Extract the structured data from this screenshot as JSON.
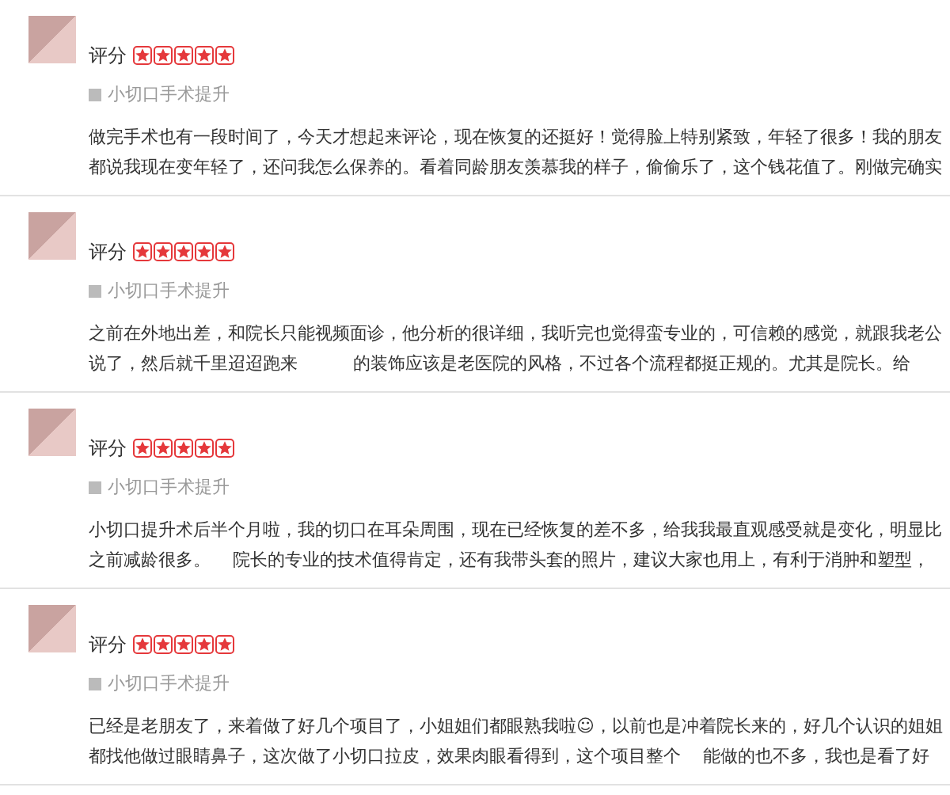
{
  "reviews": [
    {
      "rating_label": "评分",
      "stars": 5,
      "tag": "小切口手术提升",
      "text": "做完手术也有一段时间了，今天才想起来评论，现在恢复的还挺好！觉得脸上特别紧致，年轻了很多！我的朋友都说我现在变年轻了，还问我怎么保养的。看着同龄朋友羡慕我的样子，偷偷乐了，这个钱花值了。刚做完确实"
    },
    {
      "rating_label": "评分",
      "stars": 5,
      "tag": "小切口手术提升",
      "text": "之前在外地出差，和院长只能视频面诊，他分析的很详细，我听完也觉得蛮专业的，可信赖的感觉，就跟我老公说了，然后就千里迢迢跑来          的装饰应该是老医院的风格，不过各个流程都挺正规的。尤其是院长。给"
    },
    {
      "rating_label": "评分",
      "stars": 5,
      "tag": "小切口手术提升",
      "text": "小切口提升术后半个月啦，我的切口在耳朵周围，现在已经恢复的差不多，给我我最直观感受就是变化，明显比之前减龄很多。    院长的专业的技术值得肯定，还有我带头套的照片，建议大家也用上，有利于消肿和塑型，"
    },
    {
      "rating_label": "评分",
      "stars": 5,
      "tag": "小切口手术提升",
      "text": "已经是老朋友了，来着做了好几个项目了，小姐姐们都眼熟我啦☺，以前也是冲着院长来的，好几个认识的姐姐都找他做过眼睛鼻子，这次做了小切口拉皮，效果肉眼看得到，这个项目整个    能做的也不多，我也是看了好"
    }
  ]
}
